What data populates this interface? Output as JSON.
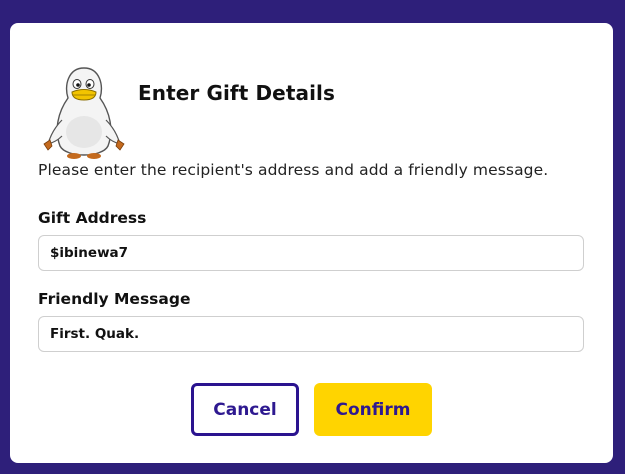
{
  "dialog": {
    "title": "Enter Gift Details",
    "description": "Please enter the recipient's address and add a friendly message.",
    "mascot_icon": "duck-mascot-icon"
  },
  "fields": {
    "address": {
      "label": "Gift Address",
      "value": "$ibinewa7"
    },
    "message": {
      "label": "Friendly Message",
      "value": "First. Quak."
    }
  },
  "buttons": {
    "cancel_label": "Cancel",
    "confirm_label": "Confirm"
  },
  "colors": {
    "backdrop": "#2e1f7a",
    "accent": "#2a138f",
    "confirm_bg": "#ffd400"
  }
}
